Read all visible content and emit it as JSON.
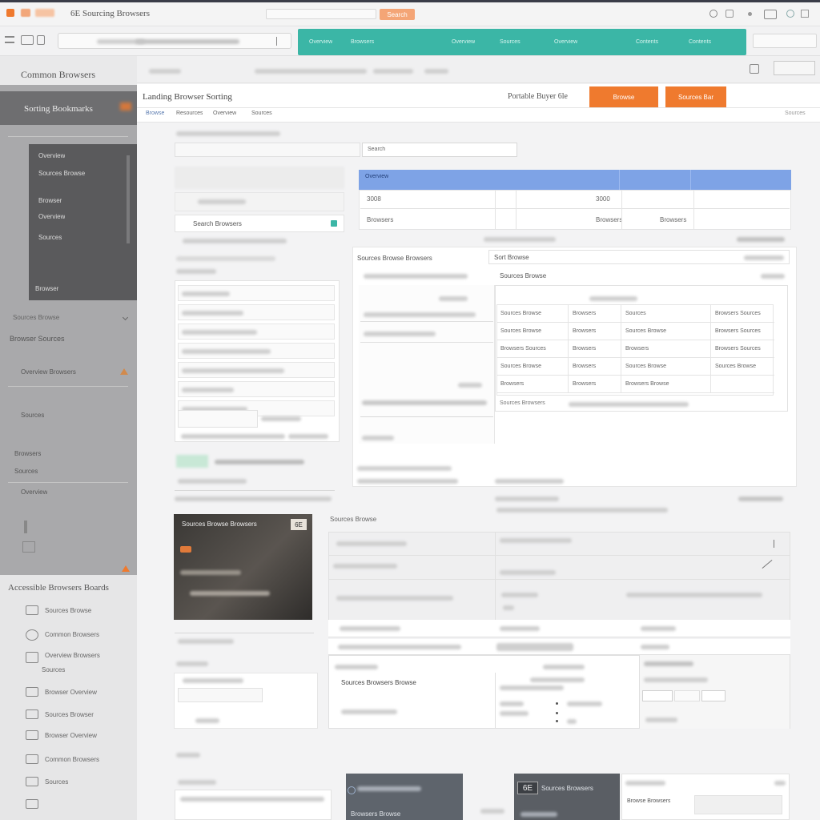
{
  "topbar": {
    "title": "6E Sourcing Browsers",
    "tag_label": "Search"
  },
  "toolbar": {
    "address": "",
    "tabs": [
      "Overview",
      "Browsers",
      "Overview",
      "Sources",
      "Overview",
      "Contents",
      "Contents"
    ]
  },
  "sidebar": {
    "header": "Common Browsers",
    "selected": "Sorting Bookmarks",
    "dark_items": [
      "Overview",
      "Sources Browse",
      "Browser",
      "Overview",
      "Sources",
      "Browser"
    ],
    "sub_items": [
      "Sources Browse",
      "Browser Sources",
      "Overview Browsers",
      "Sources",
      "Browsers",
      "Sources",
      "Overview"
    ],
    "section_title": "Accessible Browsers Boards",
    "list": [
      "Sources Browse",
      "Common Browsers",
      "Overview Browsers",
      "Sources",
      "Browser Overview",
      "Sources Browser",
      "Browser Overview",
      "Common Browsers",
      "Sources"
    ]
  },
  "content": {
    "title": "Landing Browser Sorting",
    "right_label": "Portable Buyer 6le",
    "btn_primary": "Browse",
    "btn_secondary": "Sources Bar",
    "subtabs": [
      "Browse",
      "Resources",
      "Overview",
      "Sources"
    ],
    "page_link": "Sources",
    "search_placeholder": "Search",
    "card_label": "Search Browsers",
    "table_header": [
      "Overview",
      "",
      "",
      ""
    ],
    "table_rows": [
      [
        "3008",
        "",
        "3000",
        ""
      ],
      [
        "Browsers",
        "",
        "Browsers",
        "Browsers"
      ]
    ],
    "form_label": "Sources Browse Browsers",
    "form_value": "Sort Browse",
    "subpanel_title": "Sources Browse",
    "grid": [
      [
        "Sources Browse",
        "Browsers",
        "Sources",
        "Browsers Sources"
      ],
      [
        "Sources Browse",
        "Browsers",
        "Sources Browse",
        "Browsers Sources"
      ],
      [
        "Browsers Sources",
        "Browsers",
        "Browsers",
        "Browsers Sources"
      ],
      [
        "Sources Browse",
        "Browsers",
        "Sources Browse",
        "Sources Browse"
      ],
      [
        "Browsers",
        "Browsers",
        "Browsers Browse",
        ""
      ]
    ],
    "footer_note": "Sources Browsers",
    "section2_title": "Sources Browse",
    "thumb_title": "Sources Browse Browsers",
    "thumb_badge": "6E",
    "bottom_card_title": "Sources Browsers Browse",
    "bottom_card_sub": "Browsers Browse",
    "bottom_badge_1": "6E",
    "bottom_badge_label": "Sources Browsers",
    "bottom_label_2": "Browse Browsers"
  }
}
